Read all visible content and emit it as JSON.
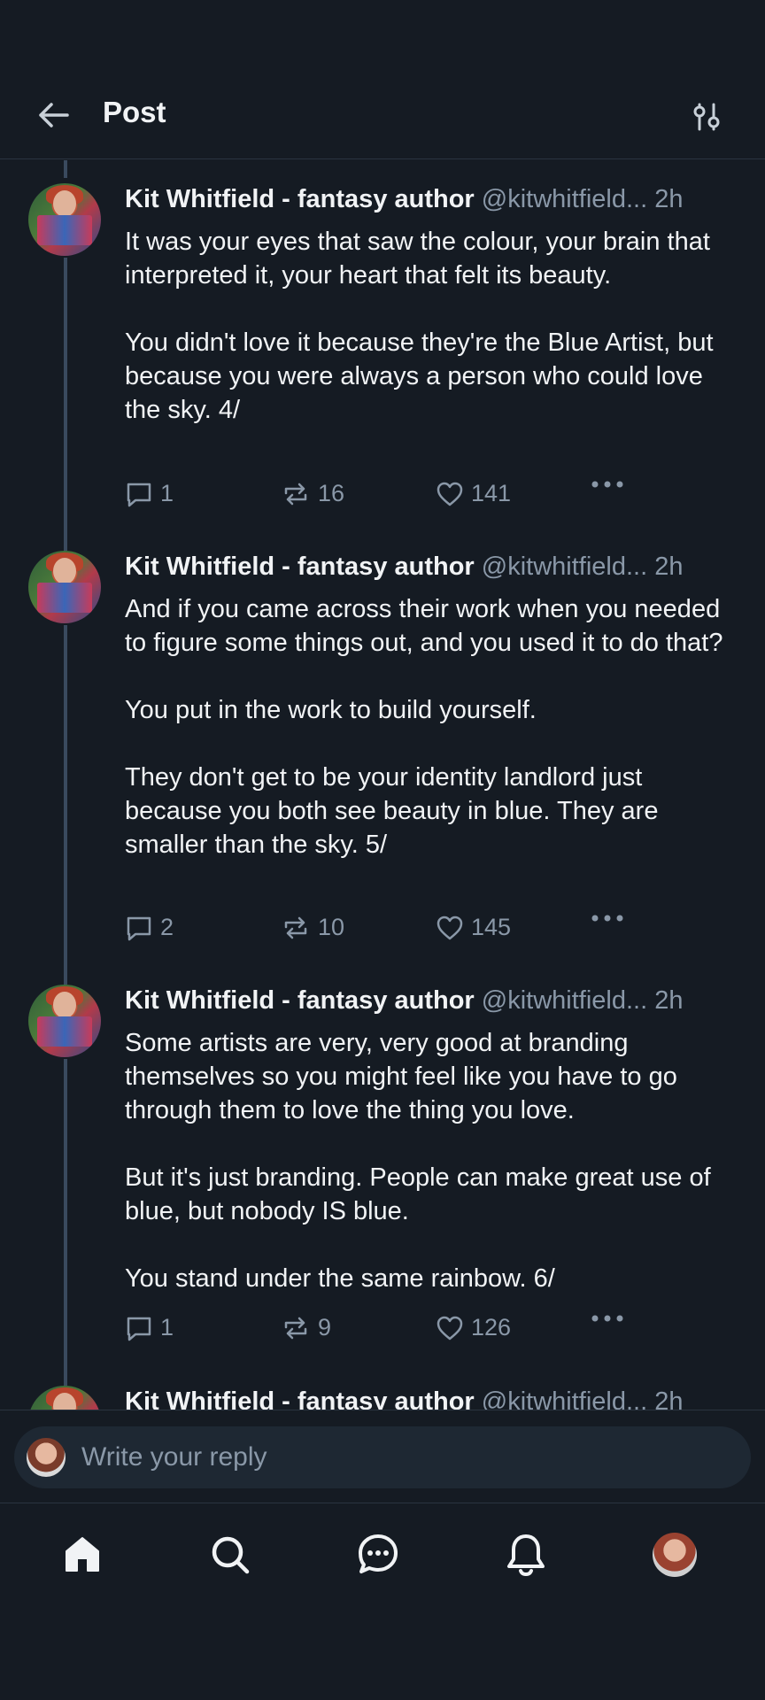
{
  "header": {
    "title": "Post"
  },
  "posts": [
    {
      "author": "Kit Whitfield - fantasy author",
      "handle": "@kitwhitfield...",
      "time": "2h",
      "paragraphs": [
        "It was your eyes that saw the colour, your brain that interpreted it, your heart that felt its beauty.",
        "You didn't love it because they're the Blue Artist, but because you were always a person who could love the sky. 4/"
      ],
      "replies": "1",
      "reposts": "16",
      "likes": "141"
    },
    {
      "author": "Kit Whitfield - fantasy author",
      "handle": "@kitwhitfield...",
      "time": "2h",
      "paragraphs": [
        "And if you came across their work when you needed to figure some things out, and you used it to do that?",
        "You put in the work to build yourself.",
        "They don't get to be your identity landlord just because you both see beauty in blue. They are smaller than the sky. 5/"
      ],
      "replies": "2",
      "reposts": "10",
      "likes": "145"
    },
    {
      "author": "Kit Whitfield - fantasy author",
      "handle": "@kitwhitfield...",
      "time": "2h",
      "paragraphs": [
        "Some artists are very, very good at branding themselves so you might feel like you have to go through them to love the thing you love.",
        "But it's just branding. People can make great use of blue, but nobody IS blue.",
        "You stand under the same rainbow. 6/"
      ],
      "replies": "1",
      "reposts": "9",
      "likes": "126"
    },
    {
      "author": "Kit Whitfield - fantasy author",
      "handle": "@kitwhitfield...",
      "time": "2h"
    }
  ],
  "reply": {
    "placeholder": "Write your reply"
  },
  "icons": {
    "back": "arrow-left-icon",
    "filter": "sliders-icon",
    "reply": "speech-bubble-icon",
    "repost": "repost-icon",
    "like": "heart-icon",
    "more": "ellipsis-icon",
    "nav": [
      "home-icon",
      "search-icon",
      "chat-icon",
      "bell-icon",
      "profile-avatar"
    ]
  },
  "colors": {
    "background": "#151b23",
    "text": "#f1f3f5",
    "muted": "#8a98a8",
    "thread": "#3a4a5e",
    "input": "#1e2833"
  }
}
